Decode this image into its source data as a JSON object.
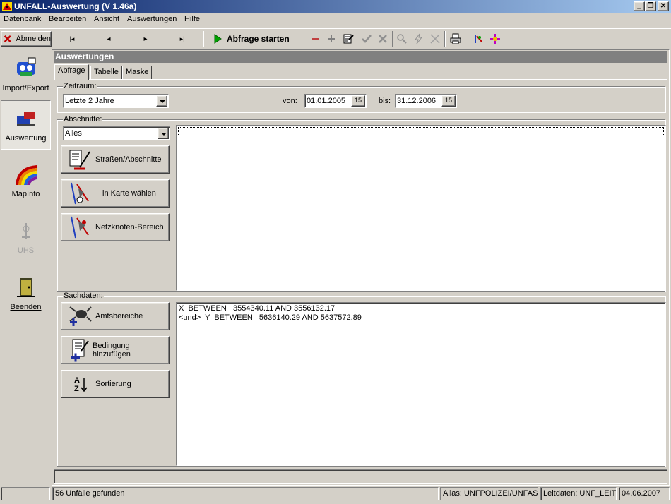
{
  "window": {
    "title": "UNFALL-Auswertung (V 1.46a)",
    "controls": [
      "_",
      "❐",
      "✕"
    ]
  },
  "menu": [
    "Datenbank",
    "Bearbeiten",
    "Ansicht",
    "Auswertungen",
    "Hilfe"
  ],
  "toolbar": {
    "logout_label": "Abmelden",
    "run_query_label": "Abfrage starten",
    "nav": [
      "|◂",
      "◂",
      "▸",
      "▸|"
    ]
  },
  "sidebar": {
    "items": [
      {
        "label": "Import/Export"
      },
      {
        "label": "Auswertung"
      },
      {
        "label": "MapInfo"
      },
      {
        "label": "UHS"
      },
      {
        "label": "Beenden"
      }
    ]
  },
  "main": {
    "header": "Auswertungen",
    "tabs": [
      "Abfrage",
      "Tabelle",
      "Maske"
    ],
    "zeitraum": {
      "label": "Zeitraum:",
      "selected": "Letzte 2 Jahre",
      "von_label": "von:",
      "von": "01.01.2005",
      "bis_label": "bis:",
      "bis": "31.12.2006",
      "cal_icon_text": "15"
    },
    "abschnitte": {
      "label": "Abschnitte:",
      "selected": "Alles",
      "buttons": [
        "Straßen/Abschnitte",
        "in Karte wählen",
        "Netzknoten-Bereich"
      ]
    },
    "sachdaten": {
      "label": "Sachdaten:",
      "buttons": [
        "Amtsbereiche",
        "Bedingung hinzufügen",
        "Sortierung"
      ],
      "lines": [
        "X  BETWEEN   3554340.11 AND 3556132.17",
        "<und>  Y  BETWEEN   5636140.29 AND 5637572.89"
      ]
    }
  },
  "status": {
    "count": "56 Unfälle gefunden",
    "alias": "Alias: UNFPOLIZEI/UNFAS",
    "leitdaten": "Leitdaten: UNF_LEIT",
    "date": "04.06.2007"
  }
}
